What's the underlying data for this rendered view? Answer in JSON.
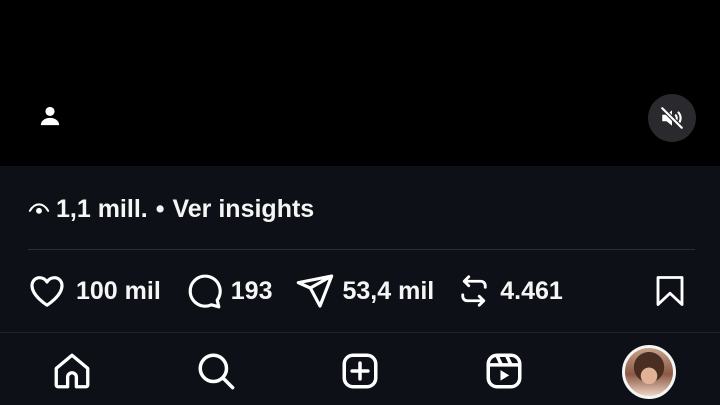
{
  "post": {
    "views": "1,1 mill.",
    "separator": "•",
    "insights_link": "Ver insights"
  },
  "actions": {
    "likes": "100 mil",
    "comments": "193",
    "shares": "53,4 mil",
    "reposts": "4.461"
  },
  "icons": {
    "tag": "user-tag-icon",
    "mute": "speaker-muted-icon",
    "views": "eye-icon",
    "like": "heart-icon",
    "comment": "comment-icon",
    "share": "send-icon",
    "repost": "repost-icon",
    "save": "bookmark-icon",
    "nav": [
      "home-icon",
      "search-icon",
      "create-icon",
      "reels-icon",
      "profile-avatar"
    ]
  },
  "colors": {
    "background": "#0d1117",
    "video_background": "#000000",
    "text": "#f5f5f5"
  }
}
